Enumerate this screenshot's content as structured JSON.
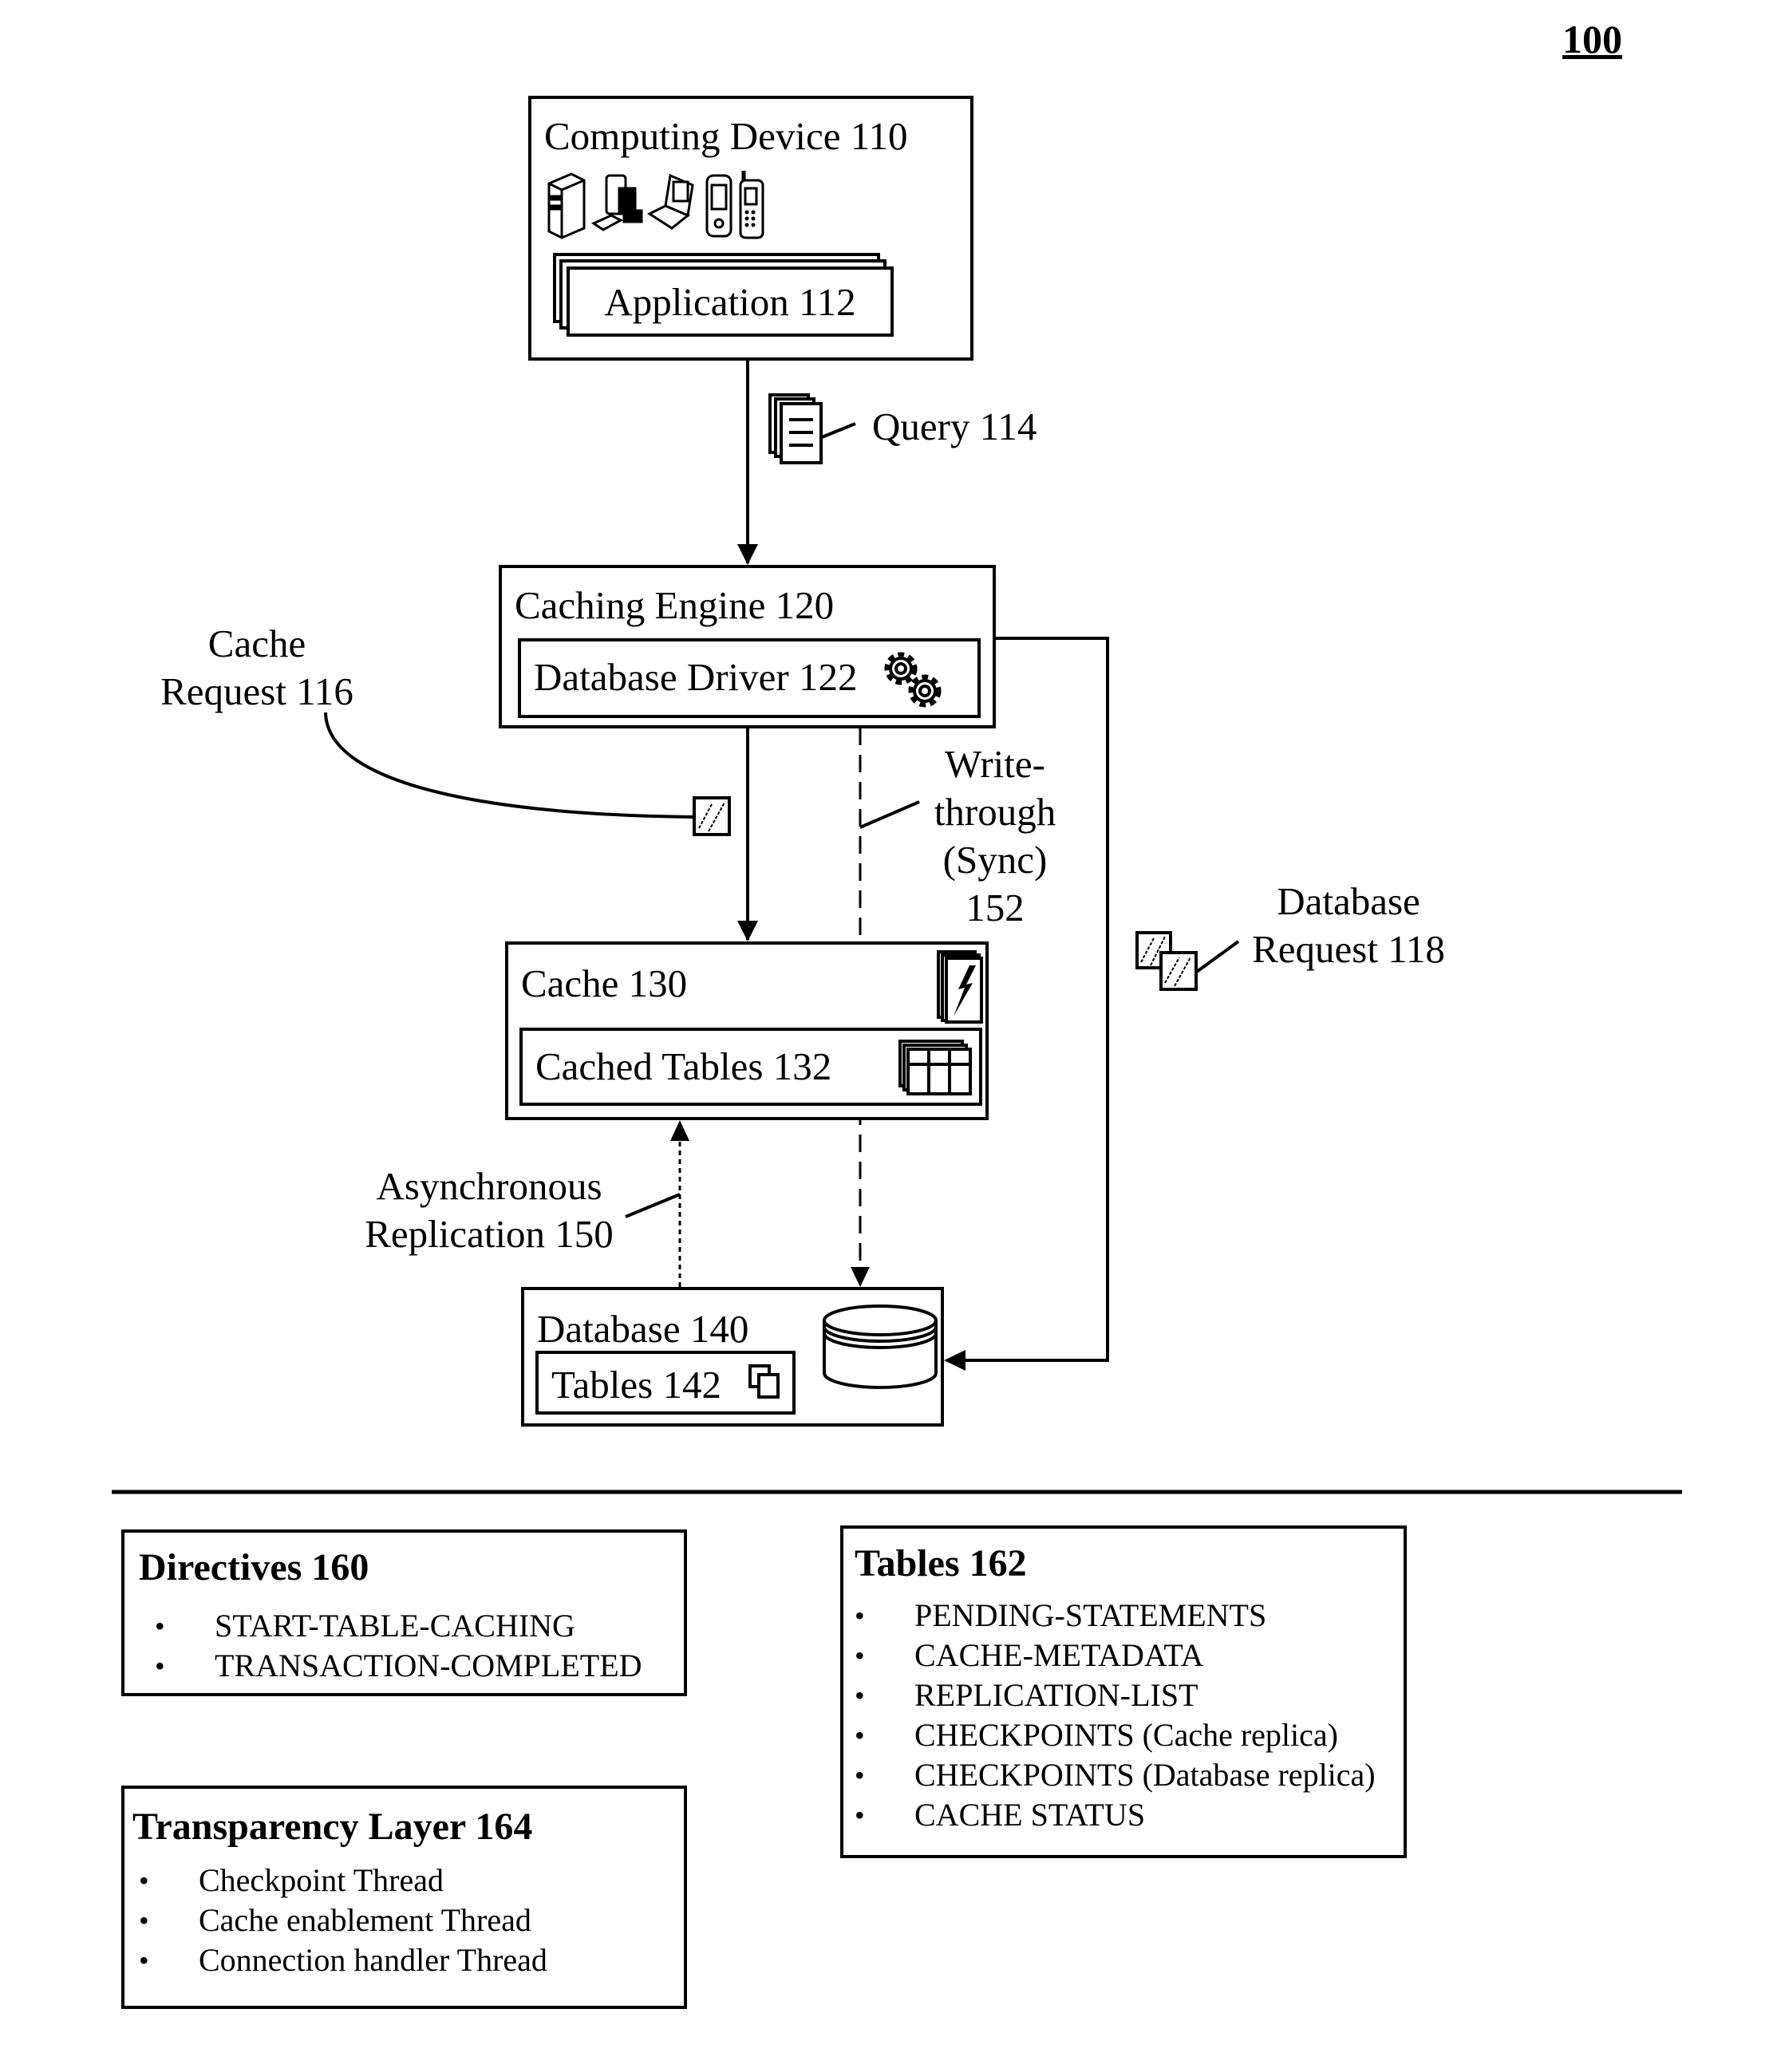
{
  "figure_number": "100",
  "nodes": {
    "computing_device": {
      "label": "Computing Device 110",
      "devices": [
        "server-icon",
        "desktop-icon",
        "laptop-icon",
        "pda-icon",
        "mobile-phone-icon"
      ]
    },
    "application": {
      "label": "Application 112"
    },
    "query": {
      "label": "Query 114"
    },
    "caching_engine": {
      "label": "Caching Engine 120"
    },
    "database_driver": {
      "label": "Database Driver 122"
    },
    "cache_request": {
      "line1": "Cache",
      "line2": "Request 116"
    },
    "write_through": {
      "line1": "Write-",
      "line2": "through",
      "line3": "(Sync)",
      "line4": "152"
    },
    "database_request": {
      "line1": "Database",
      "line2": "Request 118"
    },
    "cache": {
      "label": "Cache 130"
    },
    "cached_tables": {
      "label": "Cached Tables 132"
    },
    "async_replication": {
      "line1": "Asynchronous",
      "line2": "Replication 150"
    },
    "database": {
      "label": "Database 140"
    },
    "tables": {
      "label": "Tables 142"
    }
  },
  "legend": {
    "directives": {
      "title": "Directives 160",
      "items": [
        "START-TABLE-CACHING",
        "TRANSACTION-COMPLETED"
      ]
    },
    "tables": {
      "title": "Tables 162",
      "items": [
        "PENDING-STATEMENTS",
        "CACHE-METADATA",
        "REPLICATION-LIST",
        "CHECKPOINTS (Cache replica)",
        "CHECKPOINTS (Database replica)",
        "CACHE STATUS"
      ]
    },
    "transparency": {
      "title": "Transparency Layer 164",
      "items": [
        "Checkpoint Thread",
        "Cache enablement Thread",
        "Connection handler Thread"
      ]
    },
    "bullet": "•"
  }
}
